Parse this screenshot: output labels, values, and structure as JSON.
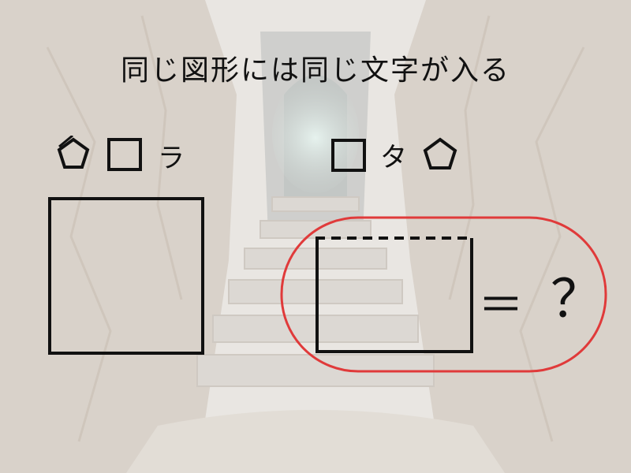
{
  "puzzle": {
    "instruction": "同じ図形には同じ文字が入る",
    "left_clue": {
      "shapes": [
        "pentagon-icon",
        "square-icon"
      ],
      "kana": "ラ"
    },
    "right_clue": {
      "shapes": [
        "square-icon",
        "pentagon-icon"
      ],
      "kana": "タ"
    },
    "equation": {
      "equals": "＝",
      "question": "？"
    },
    "highlight_color": "#e03a3a"
  }
}
